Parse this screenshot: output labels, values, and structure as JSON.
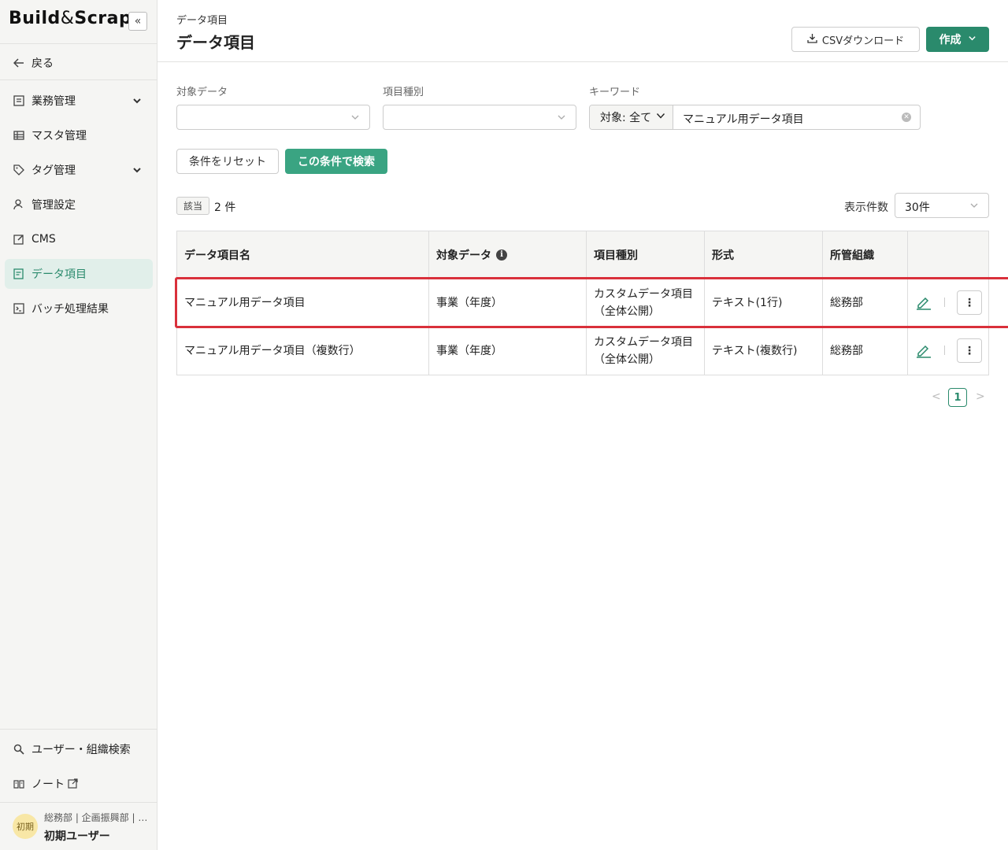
{
  "app": {
    "logo_main": "Build",
    "logo_amp": "&",
    "logo_tail": "Scrap",
    "collapse_glyph": "«"
  },
  "sidebar": {
    "back_label": "戻る",
    "items": [
      {
        "label": "業務管理",
        "has_chevron": true
      },
      {
        "label": "マスタ管理"
      },
      {
        "label": "タグ管理",
        "has_chevron": true
      },
      {
        "label": "管理設定"
      },
      {
        "label": "CMS"
      },
      {
        "label": "データ項目",
        "active": true
      },
      {
        "label": "バッチ処理結果"
      }
    ],
    "bottom": [
      {
        "label": "ユーザー・組織検索"
      },
      {
        "label": "ノート"
      }
    ],
    "user": {
      "avatar_text": "初期",
      "org": "総務部 | 企画振興部 | …",
      "name": "初期ユーザー"
    }
  },
  "header": {
    "breadcrumb": "データ項目",
    "title": "データ項目",
    "csv_label": "CSVダウンロード",
    "create_label": "作成"
  },
  "filters": {
    "target_label": "対象データ",
    "type_label": "項目種別",
    "keyword_label": "キーワード",
    "scope_value": "対象: 全て",
    "keyword_value": "マニュアル用データ項目",
    "reset_label": "条件をリセット",
    "search_label": "この条件で検索"
  },
  "results": {
    "badge": "該当",
    "count": "2 件",
    "perpage_label": "表示件数",
    "perpage_value": "30件"
  },
  "table": {
    "columns": [
      "データ項目名",
      "対象データ",
      "項目種別",
      "形式",
      "所管組織"
    ],
    "rows": [
      {
        "name": "マニュアル用データ項目",
        "target": "事業（年度）",
        "type1": "カスタムデータ項目",
        "type2": "（全体公開）",
        "format": "テキスト(1行)",
        "org": "総務部"
      },
      {
        "name": "マニュアル用データ項目（複数行）",
        "target": "事業（年度）",
        "type1": "カスタムデータ項目",
        "type2": "（全体公開）",
        "format": "テキスト(複数行)",
        "org": "総務部"
      }
    ]
  },
  "pagination": {
    "current": "1",
    "prev": "<",
    "next": ">"
  },
  "colors": {
    "accent": "#2a8a6c",
    "highlight": "#d9303b",
    "active_bg": "#e1efea"
  }
}
